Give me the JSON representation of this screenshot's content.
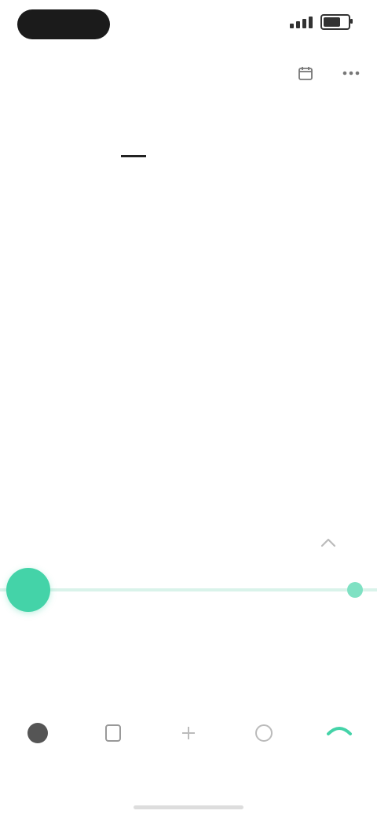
{
  "status": {
    "time": "",
    "battery_level": 0.8
  },
  "header": {
    "title": ""
  },
  "tabs": [
    {
      "label": ""
    },
    {
      "label": ""
    },
    {
      "label": ""
    },
    {
      "label": ""
    }
  ],
  "summary": {
    "label": "",
    "value": "",
    "unit": "",
    "sub": "",
    "range": ""
  },
  "stats": [
    {
      "label": "",
      "value": ""
    },
    {
      "label": "",
      "value": ""
    },
    {
      "label": "",
      "value": ""
    }
  ],
  "bottom_nav": [
    {
      "label": "",
      "icon": "home-icon"
    },
    {
      "label": "",
      "icon": "list-icon"
    },
    {
      "label": "",
      "icon": "plus-icon"
    },
    {
      "label": "",
      "icon": "chart-icon"
    },
    {
      "label": "",
      "icon": "profile-icon"
    }
  ],
  "colors": {
    "accent": "#44d3a8",
    "track": "#d9f3ea"
  }
}
